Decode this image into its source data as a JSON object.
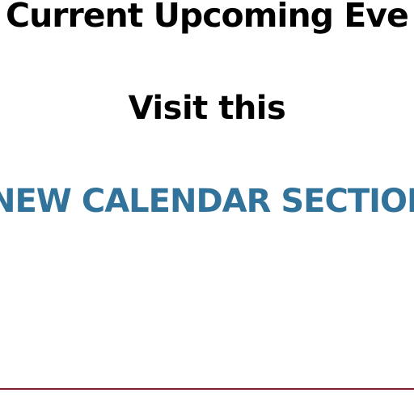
{
  "content": {
    "headline": "Current Upcoming Eve",
    "visit_text": "Visit this",
    "calendar_link_text": "NEW CALENDAR SECTION"
  },
  "colors": {
    "link": "#31739a",
    "text": "#000000",
    "divider": "#7a1f2b",
    "background": "#ffffff"
  }
}
